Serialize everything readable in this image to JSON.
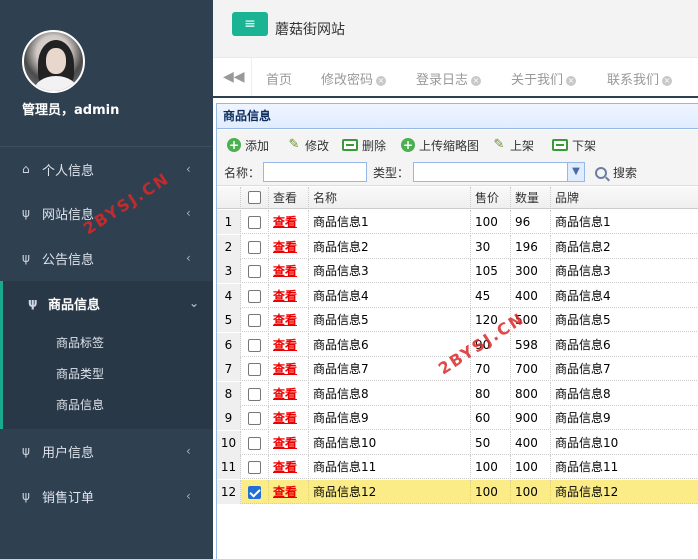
{
  "sidebar": {
    "admin_name": "管理员，admin",
    "items": [
      {
        "label": "个人信息",
        "icon": "home-icon"
      },
      {
        "label": "网站信息",
        "icon": "cutlery-icon"
      },
      {
        "label": "公告信息",
        "icon": "cutlery-icon"
      },
      {
        "label": "商品信息",
        "icon": "cutlery-icon"
      },
      {
        "label": "用户信息",
        "icon": "cutlery-icon"
      },
      {
        "label": "销售订单",
        "icon": "cutlery-icon"
      }
    ],
    "sub_items": [
      "商品标签",
      "商品类型",
      "商品信息"
    ],
    "arrow_collapsed": "‹",
    "arrow_expanded": "⌄"
  },
  "topbar": {
    "menu_icon": "≡",
    "site_title": "蘑菇街网站"
  },
  "tabs": {
    "back": "◀◀",
    "items": [
      "首页",
      "修改密码",
      "登录日志",
      "关于我们",
      "联系我们"
    ]
  },
  "panel": {
    "title": "商品信息",
    "toolbar": {
      "add": "添加",
      "edit": "修改",
      "delete": "删除",
      "upload": "上传缩略图",
      "on_shelf": "上架",
      "off_shelf": "下架"
    },
    "filter": {
      "name_label": "名称：",
      "name_value": "",
      "type_label": "类型：",
      "type_value": "",
      "search": "搜索"
    },
    "columns": [
      "查看",
      "名称",
      "售价",
      "数量",
      "品牌"
    ],
    "rows": [
      {
        "n": "1",
        "view": "查看",
        "name": "商品信息1",
        "price": "100",
        "qty": "96",
        "brand": "商品信息1",
        "checked": false
      },
      {
        "n": "2",
        "view": "查看",
        "name": "商品信息2",
        "price": "30",
        "qty": "196",
        "brand": "商品信息2",
        "checked": false
      },
      {
        "n": "3",
        "view": "查看",
        "name": "商品信息3",
        "price": "105",
        "qty": "300",
        "brand": "商品信息3",
        "checked": false
      },
      {
        "n": "4",
        "view": "查看",
        "name": "商品信息4",
        "price": "45",
        "qty": "400",
        "brand": "商品信息4",
        "checked": false
      },
      {
        "n": "5",
        "view": "查看",
        "name": "商品信息5",
        "price": "120",
        "qty": "500",
        "brand": "商品信息5",
        "checked": false
      },
      {
        "n": "6",
        "view": "查看",
        "name": "商品信息6",
        "price": "90",
        "qty": "598",
        "brand": "商品信息6",
        "checked": false
      },
      {
        "n": "7",
        "view": "查看",
        "name": "商品信息7",
        "price": "70",
        "qty": "700",
        "brand": "商品信息7",
        "checked": false
      },
      {
        "n": "8",
        "view": "查看",
        "name": "商品信息8",
        "price": "80",
        "qty": "800",
        "brand": "商品信息8",
        "checked": false
      },
      {
        "n": "9",
        "view": "查看",
        "name": "商品信息9",
        "price": "60",
        "qty": "900",
        "brand": "商品信息9",
        "checked": false
      },
      {
        "n": "10",
        "view": "查看",
        "name": "商品信息10",
        "price": "50",
        "qty": "400",
        "brand": "商品信息10",
        "checked": false
      },
      {
        "n": "11",
        "view": "查看",
        "name": "商品信息11",
        "price": "100",
        "qty": "100",
        "brand": "商品信息11",
        "checked": false
      },
      {
        "n": "12",
        "view": "查看",
        "name": "商品信息12",
        "price": "100",
        "qty": "100",
        "brand": "商品信息12",
        "checked": true
      }
    ]
  },
  "watermark": "2BYSJ.CN",
  "colors": {
    "sidebar_bg": "#2f4050",
    "accent": "#1ab394",
    "selected_row": "#fbec88",
    "view_link": "#ee0000"
  }
}
